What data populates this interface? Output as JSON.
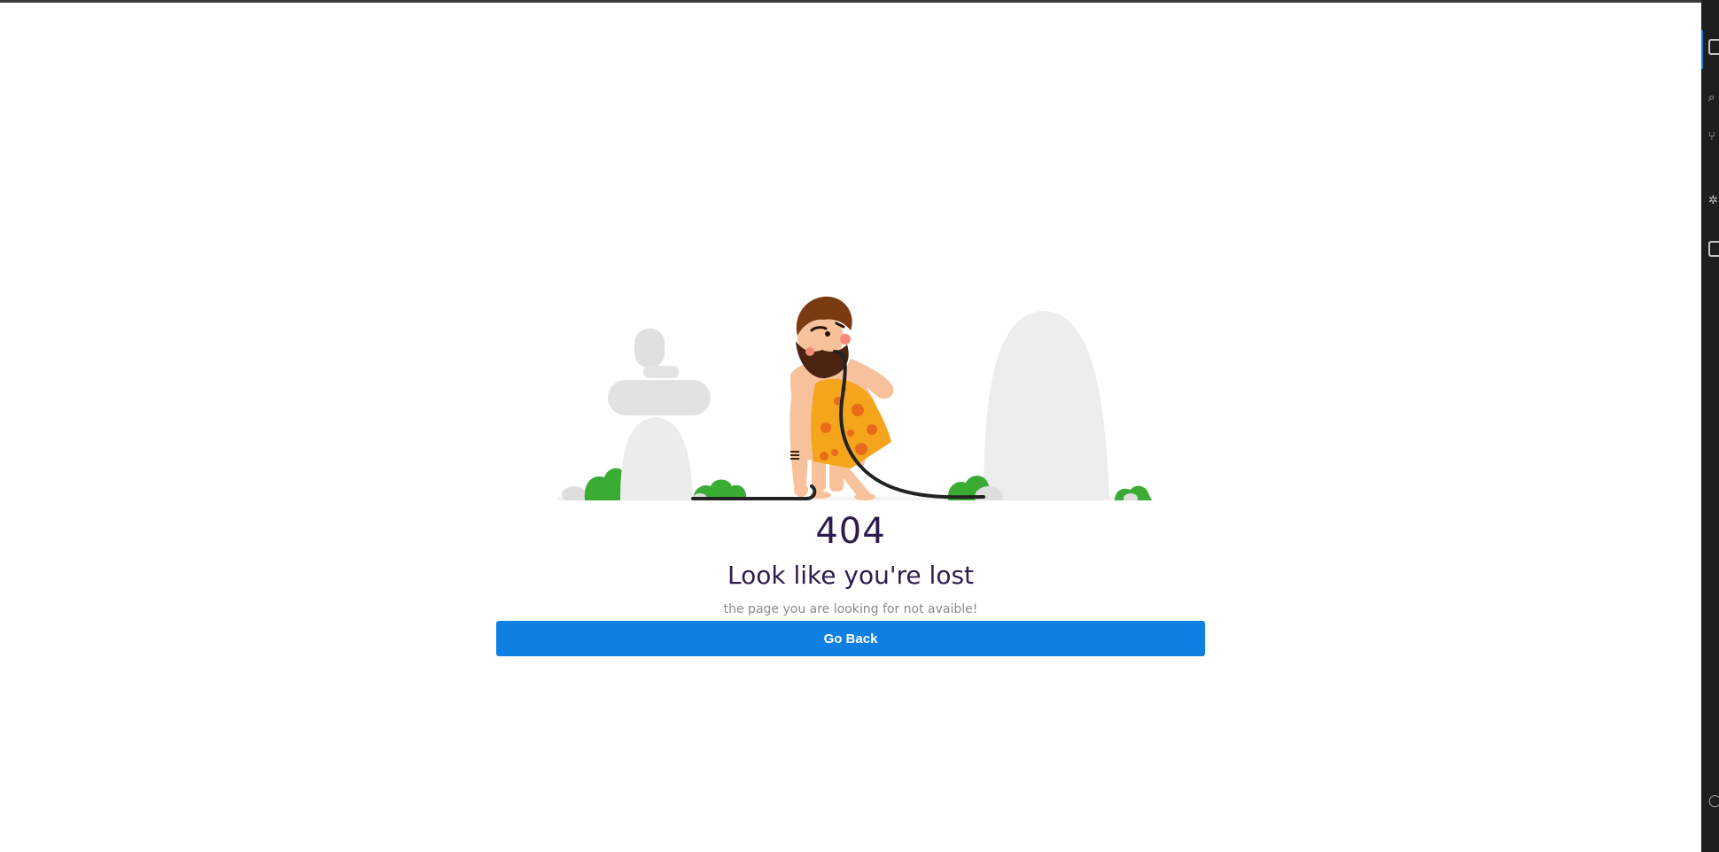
{
  "error": {
    "code": "404",
    "title": "Look like you're lost",
    "message": "the page you are looking for not avaible!",
    "button_label": "Go Back"
  },
  "colors": {
    "accent": "#0e7fe3",
    "heading": "#2d1b4e",
    "muted_text": "#8a8a8a",
    "panel_bg": "#1e1e1e"
  },
  "illustration": {
    "icon": "caveman-404-illustration"
  },
  "side_panel": {
    "icons": [
      "files-icon",
      "search-icon",
      "source-control-icon",
      "debug-icon",
      "extensions-icon",
      "account-icon"
    ]
  }
}
